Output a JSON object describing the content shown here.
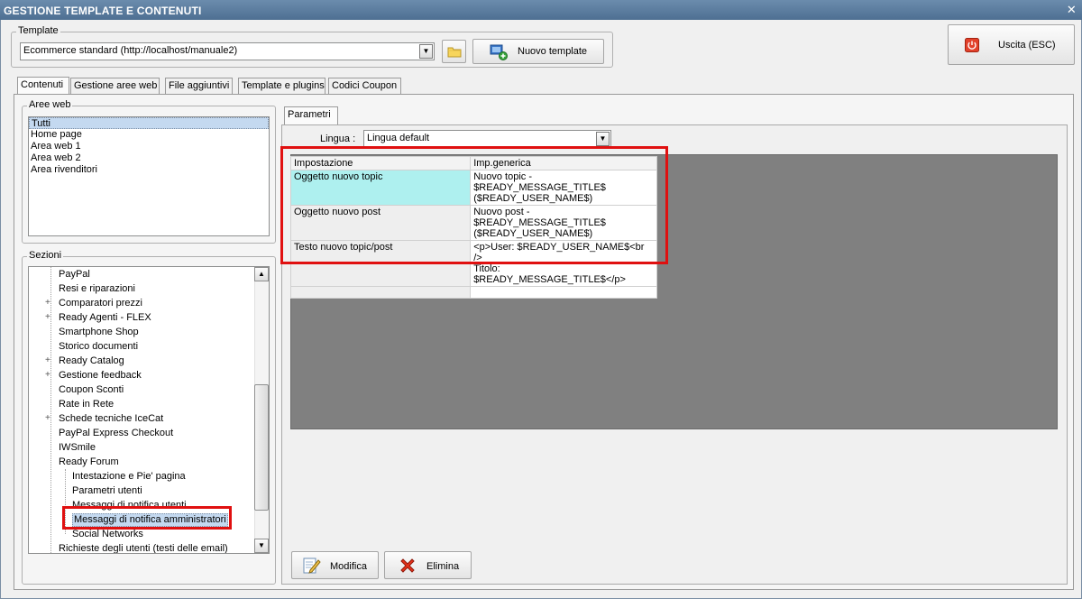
{
  "window": {
    "title": "GESTIONE TEMPLATE E CONTENUTI",
    "close_glyph": "✕"
  },
  "template_group": {
    "label": "Template",
    "selected": "Ecommerce standard (http://localhost/manuale2)",
    "new_button": "Nuovo template"
  },
  "exit_button": {
    "label": "Uscita (ESC)",
    "icon": "power-icon"
  },
  "tabs": [
    "Contenuti",
    "Gestione aree web",
    "File aggiuntivi",
    "Template e plugins",
    "Codici Coupon"
  ],
  "aree_web": {
    "label": "Aree web",
    "items": [
      "Tutti",
      "Home page",
      "Area web 1",
      "Area web 2",
      "Area rivenditori"
    ]
  },
  "sezioni": {
    "label": "Sezioni",
    "items": [
      {
        "label": "PayPal",
        "expandable": false,
        "level": 1
      },
      {
        "label": "Resi e riparazioni",
        "expandable": false,
        "level": 1
      },
      {
        "label": "Comparatori prezzi",
        "expandable": true,
        "level": 1
      },
      {
        "label": "Ready Agenti - FLEX",
        "expandable": true,
        "level": 1
      },
      {
        "label": "Smartphone Shop",
        "expandable": false,
        "level": 1
      },
      {
        "label": "Storico documenti",
        "expandable": false,
        "level": 1
      },
      {
        "label": "Ready Catalog",
        "expandable": true,
        "level": 1
      },
      {
        "label": "Gestione feedback",
        "expandable": true,
        "level": 1
      },
      {
        "label": "Coupon Sconti",
        "expandable": false,
        "level": 1
      },
      {
        "label": "Rate in Rete",
        "expandable": false,
        "level": 1
      },
      {
        "label": "Schede tecniche IceCat",
        "expandable": true,
        "level": 1
      },
      {
        "label": "PayPal Express Checkout",
        "expandable": false,
        "level": 1
      },
      {
        "label": "IWSmile",
        "expandable": false,
        "level": 1
      },
      {
        "label": "Ready Forum",
        "expandable": false,
        "level": 1
      },
      {
        "label": "Intestazione e Pie' pagina",
        "expandable": false,
        "level": 2
      },
      {
        "label": "Parametri utenti",
        "expandable": false,
        "level": 2
      },
      {
        "label": "Messaggi di notifica utenti",
        "expandable": false,
        "level": 2
      },
      {
        "label": "Messaggi di notifica amministratori",
        "expandable": false,
        "level": 2,
        "selected": true
      },
      {
        "label": "Social Networks",
        "expandable": false,
        "level": 2
      },
      {
        "label": "Richieste degli utenti (testi delle email)",
        "expandable": false,
        "level": 1
      }
    ]
  },
  "parametri": {
    "tab": "Parametri",
    "lingua_label": "Lingua :",
    "lingua_value": "Lingua default",
    "columns": [
      "Impostazione",
      "Imp.generica"
    ],
    "rows": [
      {
        "key": "Oggetto nuovo topic",
        "line1": "Nuovo topic - $READY_MESSAGE_TITLE$",
        "line2": "($READY_USER_NAME$)",
        "highlight": true
      },
      {
        "key": "Oggetto nuovo post",
        "line1": "Nuovo post - $READY_MESSAGE_TITLE$",
        "line2": "($READY_USER_NAME$)",
        "highlight": false
      },
      {
        "key": "Testo nuovo topic/post",
        "line1": "<p>User: $READY_USER_NAME$<br />",
        "line2": "Titolo: $READY_MESSAGE_TITLE$</p>",
        "highlight": false
      }
    ]
  },
  "actions": {
    "modifica": "Modifica",
    "elimina": "Elimina"
  },
  "colors": {
    "title_bar": "#5a7c9f",
    "selection_highlight": "#aef0ef",
    "annotation_red": "#e01010"
  }
}
